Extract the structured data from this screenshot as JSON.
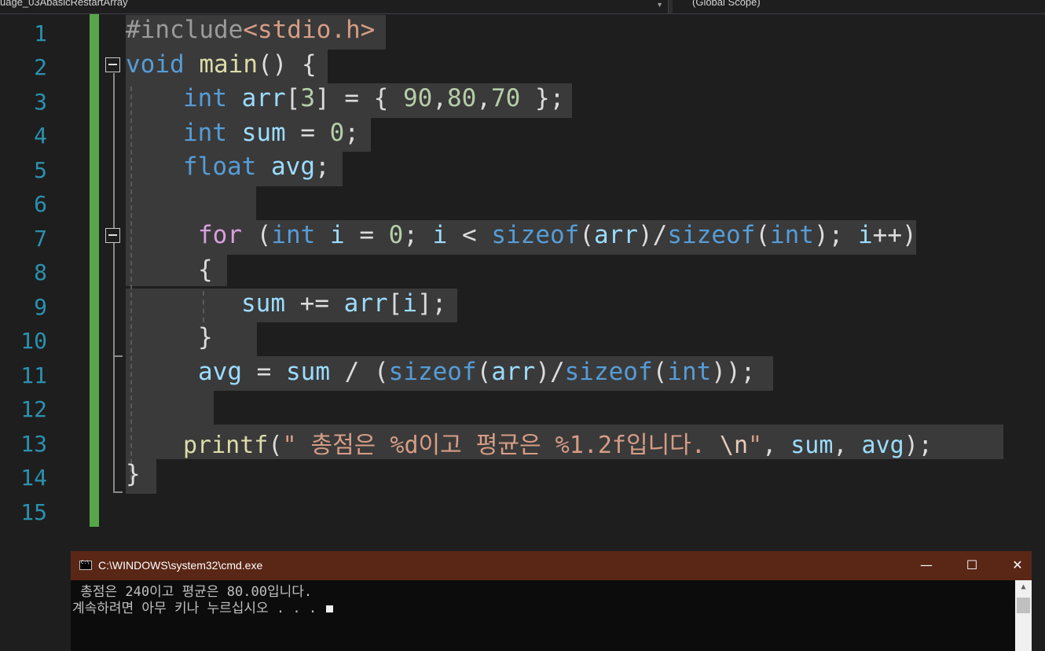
{
  "toolbar": {
    "project_dropdown": "uage_03AbasicRestartArray",
    "scope_dropdown": "(Global Scope)"
  },
  "editor": {
    "line_numbers": [
      "1",
      "2",
      "3",
      "4",
      "5",
      "6",
      "7",
      "8",
      "9",
      "10",
      "11",
      "12",
      "13",
      "14",
      "15"
    ],
    "lines": [
      "#include<stdio.h>",
      "void main() {",
      "int arr[3] = { 90,80,70 };",
      "int sum = 0;",
      "float avg;",
      "",
      "for (int i = 0; i < sizeof(arr)/sizeof(int); i++)",
      "{",
      "sum += arr[i];",
      "}",
      "avg = sum / (sizeof(arr)/sizeof(int));",
      "",
      "printf(\" 총점은 %d이고 평균은 %1.2f입니다. \\n\", sum, avg);",
      "}",
      ""
    ]
  },
  "console": {
    "title": "C:\\WINDOWS\\system32\\cmd.exe",
    "minimize": "—",
    "maximize": "☐",
    "close": "✕",
    "output_line1": " 총점은 240이고 평균은 80.00입니다.",
    "output_line2": "계속하려면 아무 키나 누르십시오 . . . "
  }
}
